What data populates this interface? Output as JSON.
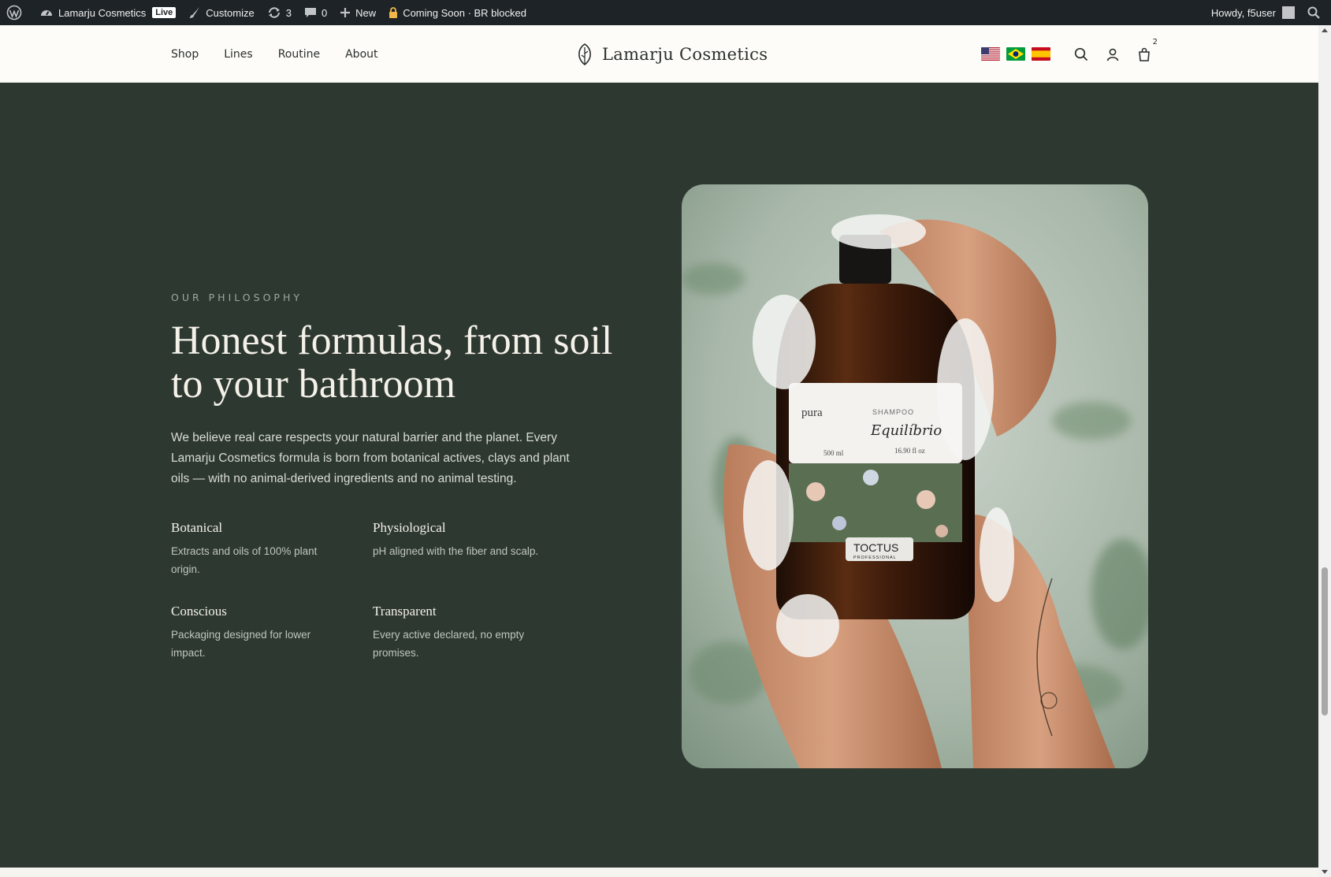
{
  "admin_bar": {
    "site_name": "Lamarju Cosmetics",
    "live_badge": "Live",
    "customize": "Customize",
    "updates_count": "3",
    "comments_count": "0",
    "new_label": "New",
    "coming_soon": "Coming Soon · BR blocked",
    "howdy": "Howdy, f5user"
  },
  "header": {
    "nav": [
      "Shop",
      "Lines",
      "Routine",
      "About"
    ],
    "logo_text": "Lamarju Cosmetics",
    "cart_count": "2",
    "flags": [
      "us-flag",
      "br-flag",
      "es-flag"
    ]
  },
  "philosophy": {
    "eyebrow": "OUR PHILOSOPHY",
    "headline": "Honest formulas, from soil to your bathroom",
    "lead": "We believe real care respects your natural barrier and the planet. Every Lamarju Cosmetics formula is born from botanical actives, clays and plant oils — with no animal-derived ingredients and no animal testing.",
    "features": [
      {
        "title": "Botanical",
        "text": "Extracts and oils of 100% plant origin."
      },
      {
        "title": "Physiological",
        "text": "pH aligned with the fiber and scalp."
      },
      {
        "title": "Conscious",
        "text": "Packaging designed for lower impact."
      },
      {
        "title": "Transparent",
        "text": "Every active declared, no empty promises."
      }
    ]
  },
  "product_label": {
    "brand": "pura",
    "type": "SHAMPOO",
    "name": "Equilíbrio",
    "volume_ml": "500 ml",
    "volume_oz": "16.90 fl oz",
    "maker": "TOCTUS",
    "maker_sub": "PROFESSIONAL"
  }
}
